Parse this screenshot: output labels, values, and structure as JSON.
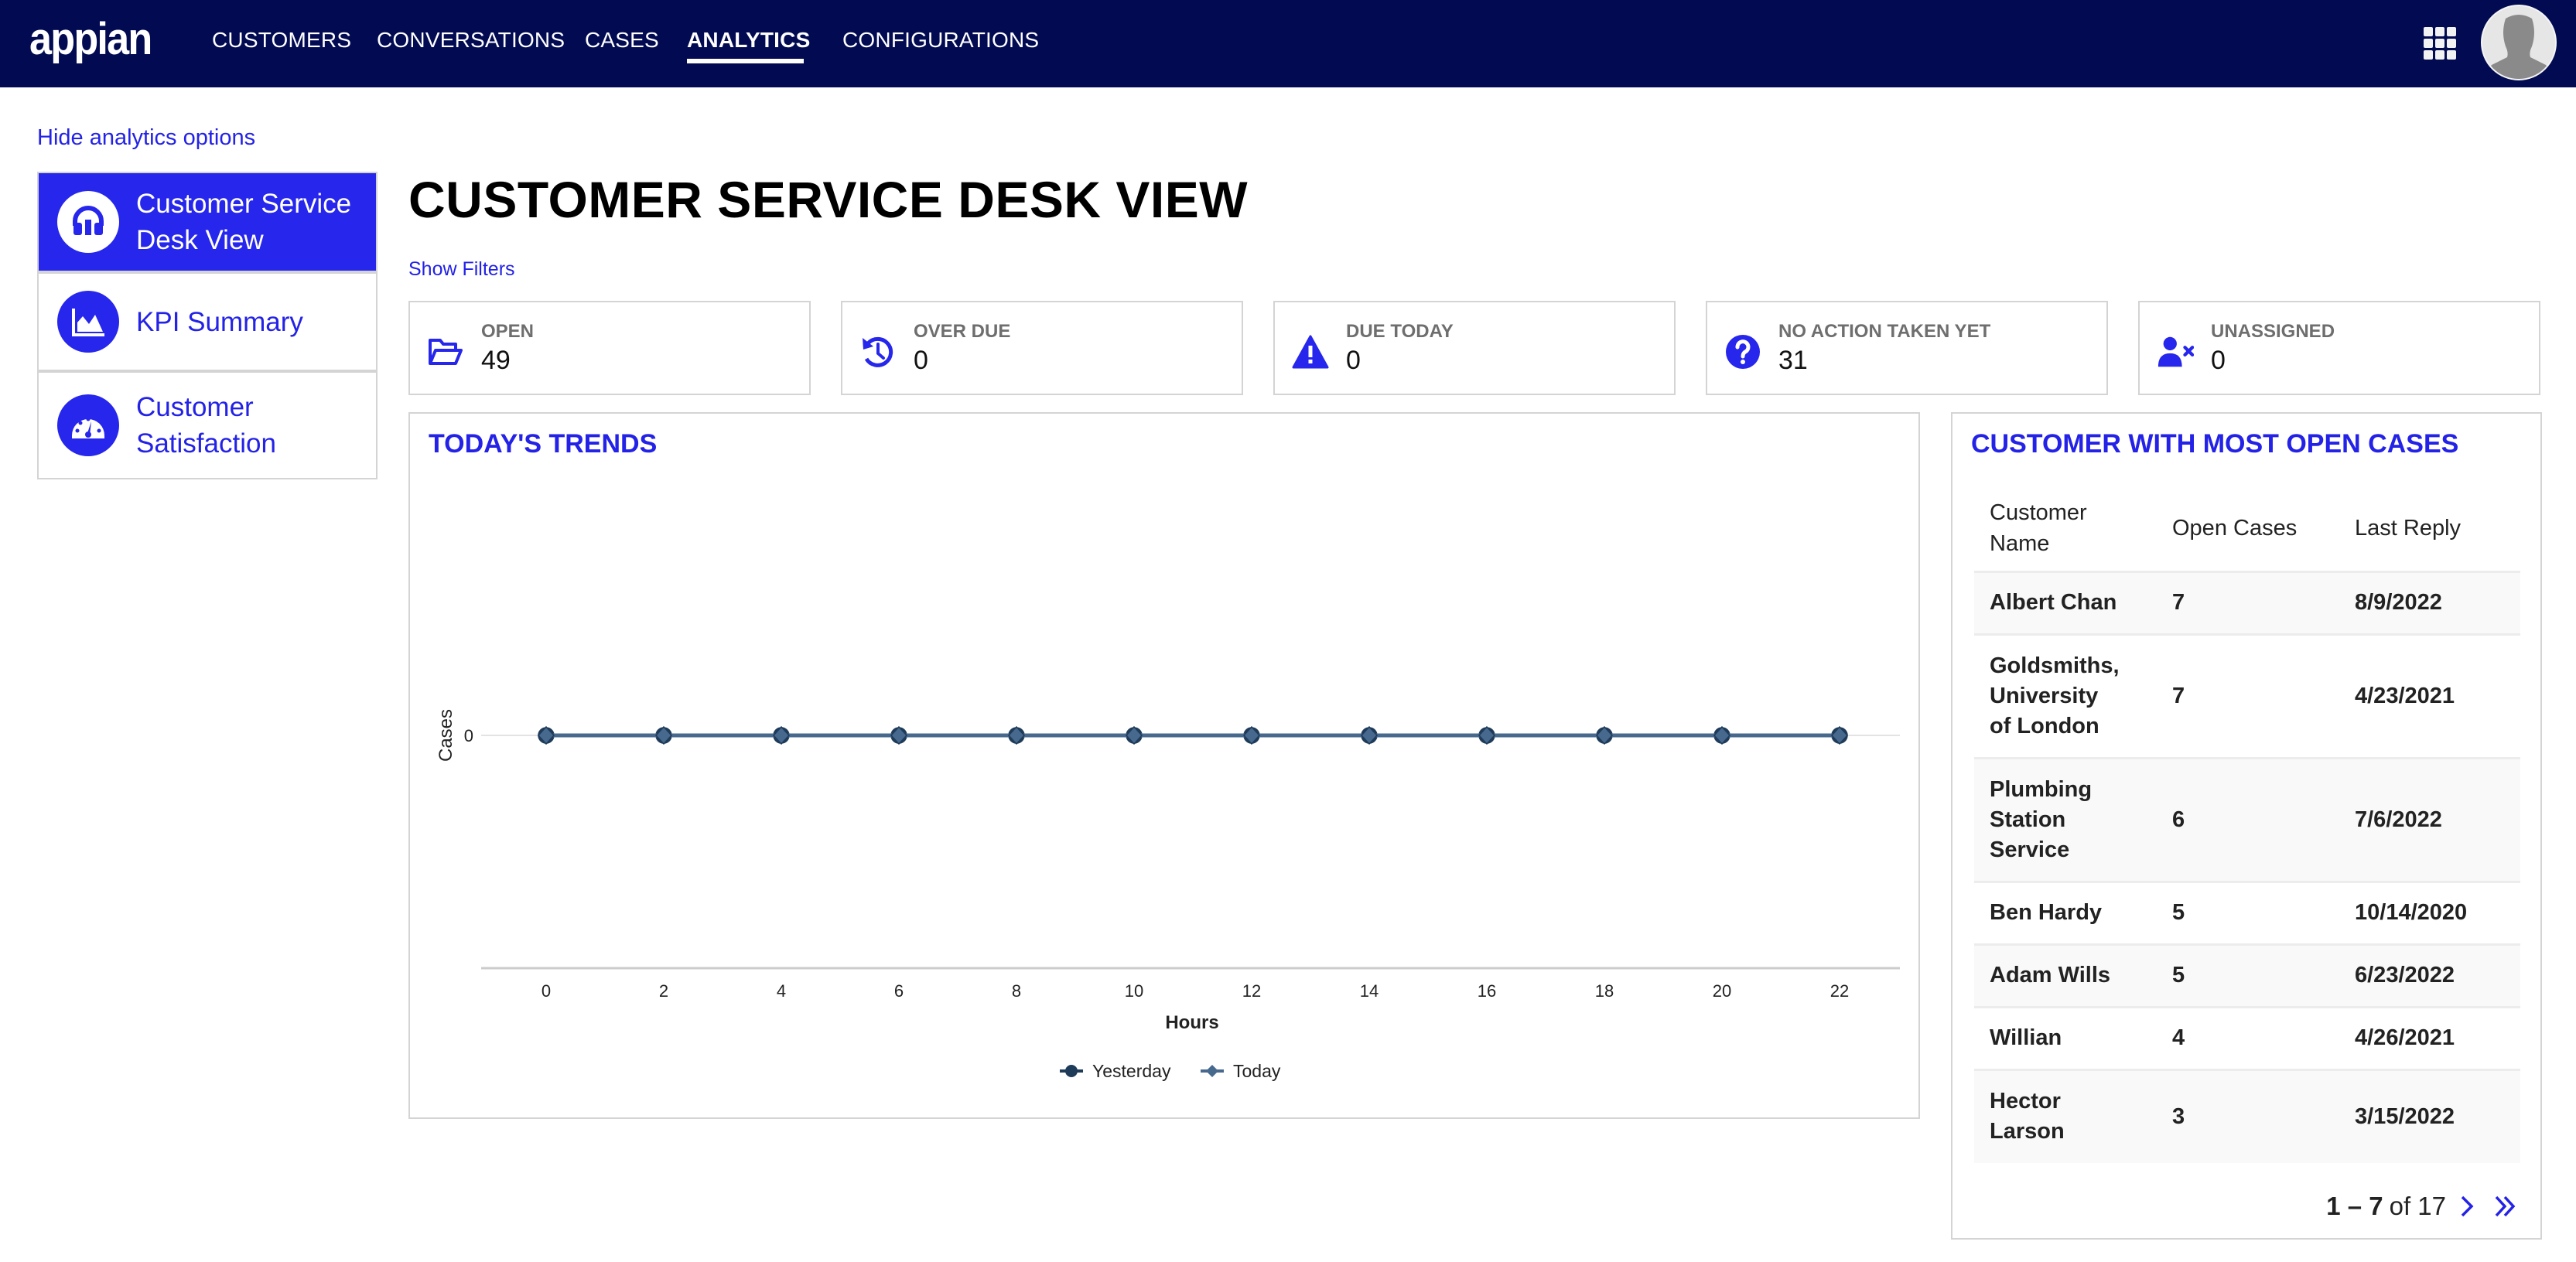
{
  "app": {
    "logo_text": "appian",
    "nav": [
      {
        "label": "CUSTOMERS",
        "active": false
      },
      {
        "label": "CONVERSATIONS",
        "active": false
      },
      {
        "label": "CASES",
        "active": false
      },
      {
        "label": "ANALYTICS",
        "active": true
      },
      {
        "label": "CONFIGURATIONS",
        "active": false
      }
    ],
    "apps_icon": "grid-icon",
    "user_icon": "avatar"
  },
  "sidebar": {
    "toggle_label": "Hide analytics options",
    "items": [
      {
        "label": "Customer Service Desk View",
        "icon": "headset-icon",
        "active": true
      },
      {
        "label": "KPI Summary",
        "icon": "area-chart-icon",
        "active": false
      },
      {
        "label": "Customer Satisfaction",
        "icon": "gauge-icon",
        "active": false
      }
    ]
  },
  "main": {
    "title": "CUSTOMER SERVICE DESK VIEW",
    "filters_link": "Show Filters",
    "kpis": [
      {
        "label": "OPEN",
        "value": "49",
        "icon": "folder-open-icon"
      },
      {
        "label": "OVER DUE",
        "value": "0",
        "icon": "history-icon"
      },
      {
        "label": "DUE TODAY",
        "value": "0",
        "icon": "warning-icon"
      },
      {
        "label": "NO ACTION TAKEN YET",
        "value": "31",
        "icon": "question-icon"
      },
      {
        "label": "UNASSIGNED",
        "value": "0",
        "icon": "user-remove-icon"
      }
    ]
  },
  "trends": {
    "title": "TODAY'S TRENDS"
  },
  "chart_data": {
    "type": "line",
    "title": "TODAY'S TRENDS",
    "xlabel": "Hours",
    "ylabel": "Cases",
    "x": [
      0,
      2,
      4,
      6,
      8,
      10,
      12,
      14,
      16,
      18,
      20,
      22
    ],
    "x_tick_labels": [
      "0",
      "2",
      "4",
      "6",
      "8",
      "10",
      "12",
      "14",
      "16",
      "18",
      "20",
      "22"
    ],
    "y_tick_labels": [
      "0"
    ],
    "ylim": [
      0,
      0
    ],
    "series": [
      {
        "name": "Yesterday",
        "marker": "circle",
        "color": "#1f3b5a",
        "values": [
          0,
          0,
          0,
          0,
          0,
          0,
          0,
          0,
          0,
          0,
          0,
          0
        ]
      },
      {
        "name": "Today",
        "marker": "diamond",
        "color": "#47698e",
        "values": [
          0,
          0,
          0,
          0,
          0,
          0,
          0,
          0,
          0,
          0,
          0,
          0
        ]
      }
    ],
    "legend": "bottom-center",
    "grid": true
  },
  "customers_panel": {
    "title": "CUSTOMER WITH MOST OPEN CASES",
    "columns": [
      "Customer Name",
      "Open Cases",
      "Last Reply"
    ],
    "rows": [
      {
        "name": "Albert Chan",
        "open_cases": "7",
        "last_reply": "8/9/2022"
      },
      {
        "name": "Goldsmiths, University of London",
        "open_cases": "7",
        "last_reply": "4/23/2021"
      },
      {
        "name": "Plumbing Station Service",
        "open_cases": "6",
        "last_reply": "7/6/2022"
      },
      {
        "name": "Ben Hardy",
        "open_cases": "5",
        "last_reply": "10/14/2020"
      },
      {
        "name": "Adam Wills",
        "open_cases": "5",
        "last_reply": "6/23/2022"
      },
      {
        "name": "Willian",
        "open_cases": "4",
        "last_reply": "4/26/2021"
      },
      {
        "name": "Hector Larson",
        "open_cases": "3",
        "last_reply": "3/15/2022"
      }
    ],
    "pagination": {
      "range": "1 – 7",
      "of_label": "of 17"
    }
  },
  "colors": {
    "nav_bg": "#020b52",
    "accent": "#2626ec",
    "link": "#2322e6",
    "border": "#d4d4d4"
  }
}
